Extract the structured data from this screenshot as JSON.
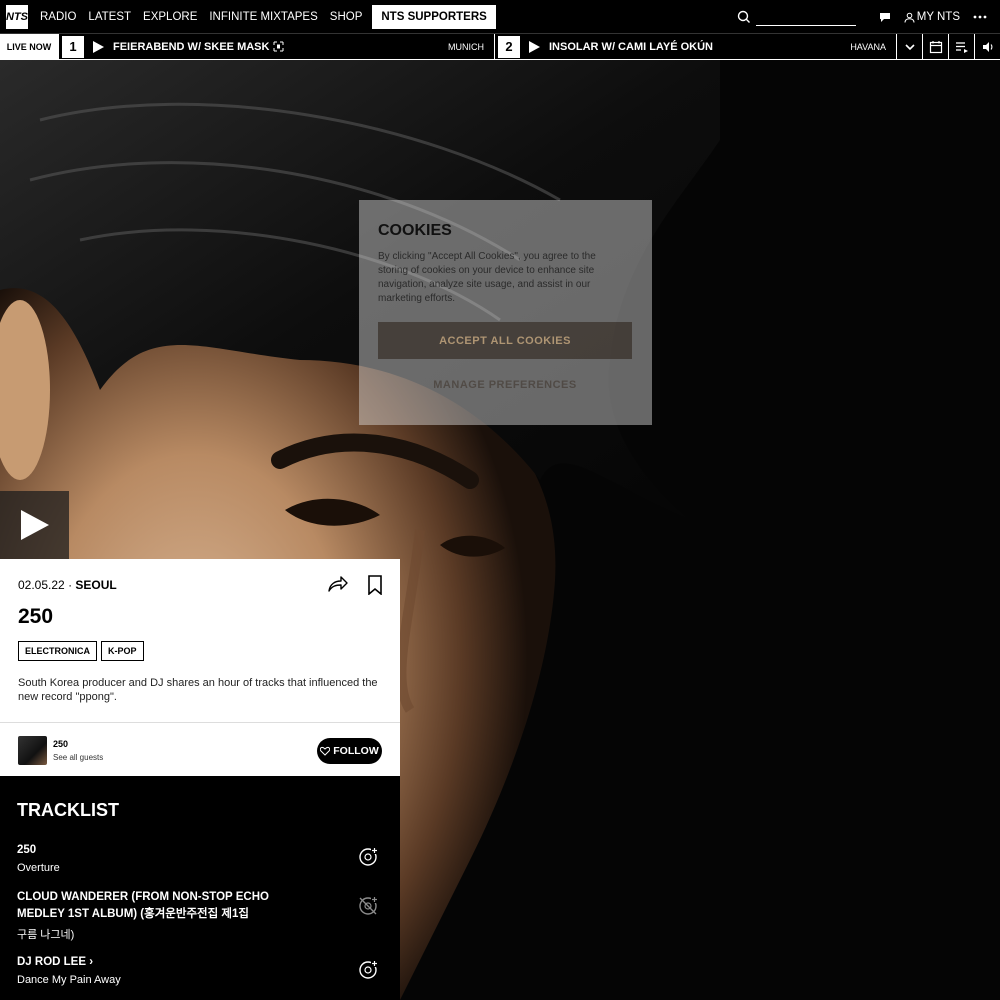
{
  "nav": {
    "logo": "NTS",
    "items": [
      "RADIO",
      "LATEST",
      "EXPLORE",
      "INFINITE MIXTAPES",
      "SHOP"
    ],
    "supporters": "NTS SUPPORTERS",
    "my_nts": "MY NTS",
    "search_placeholder": ""
  },
  "live": {
    "label": "LIVE NOW",
    "channels": [
      {
        "number": "1",
        "title": "FEIERABEND W/ SKEE MASK",
        "location": "MUNICH"
      },
      {
        "number": "2",
        "title": "INSOLAR W/ CAMI LAYÉ OKÚN",
        "location": "HAVANA"
      }
    ]
  },
  "episode": {
    "date": "02.05.22",
    "location": "SEOUL",
    "title": "250",
    "genres": [
      "ELECTRONICA",
      "K-POP"
    ],
    "description": "South Korea producer and DJ shares an hour of tracks that influenced the new record \"ppong\".",
    "guest_name": "250",
    "guest_link": "See all guests",
    "follow_label": "FOLLOW"
  },
  "tracklist": {
    "title": "TRACKLIST",
    "tracks": [
      {
        "artist": "250",
        "title": "Overture"
      },
      {
        "artist": "CLOUD WANDERER (FROM NON-STOP ECHO MEDLEY 1ST ALBUM) (홍겨운반주전집 제1집",
        "title": "구름 나그네)"
      },
      {
        "artist": "DJ ROD LEE",
        "title": "Dance My Pain Away"
      }
    ]
  },
  "cookies": {
    "title": "COOKIES",
    "text": "By clicking \"Accept All Cookies\", you agree to the storing of cookies on your device to enhance site navigation, analyze site usage, and assist in our marketing efforts.",
    "accept": "ACCEPT ALL COOKIES",
    "manage": "MANAGE PREFERENCES"
  }
}
